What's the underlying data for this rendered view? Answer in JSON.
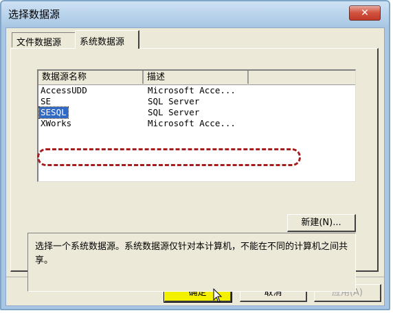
{
  "window": {
    "title": "选择数据源",
    "close_symbol": "✕"
  },
  "tabs": [
    {
      "label": "文件数据源",
      "active": false
    },
    {
      "label": "系统数据源",
      "active": true
    }
  ],
  "list": {
    "columns": [
      "数据源名称",
      "描述"
    ],
    "rows": [
      {
        "name": "AccessUDD",
        "desc": "Microsoft Acce..."
      },
      {
        "name": "SE",
        "desc": "SQL Server"
      },
      {
        "name": "SESQL",
        "desc": "SQL Server",
        "selected": true
      },
      {
        "name": "XWorks",
        "desc": "Microsoft Acce..."
      }
    ]
  },
  "buttons": {
    "new": "新建(N)...",
    "ok": "确定",
    "cancel": "取消",
    "apply": "应用(A)"
  },
  "description": "选择一个系统数据源。系统数据源仅针对本计算机，不能在不同的计算机之间共享。",
  "colors": {
    "selection": "#316ac5",
    "annotation_ring": "#a51d1d",
    "ok_highlight": "#f3f000"
  }
}
